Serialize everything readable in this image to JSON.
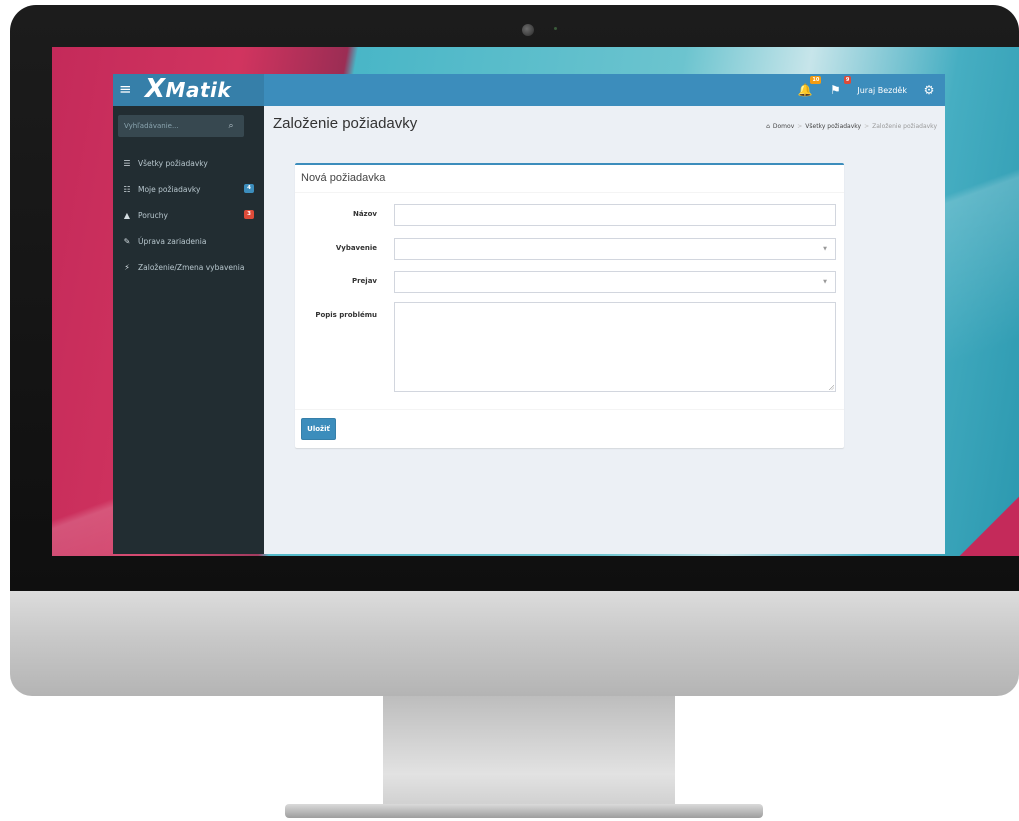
{
  "app": {
    "logo_text": "Matik",
    "logo_prefix": "X",
    "user_name": "Juraj Bezděk",
    "notifications_count": "10",
    "flags_count": "9"
  },
  "sidebar": {
    "search_placeholder": "Vyhľadávanie...",
    "items": [
      {
        "label": "Všetky požiadavky",
        "icon": "list-icon"
      },
      {
        "label": "Moje požiadavky",
        "icon": "list-ul-icon",
        "badge": "4",
        "badge_color": "#3c8dbc"
      },
      {
        "label": "Poruchy",
        "icon": "warning-icon",
        "badge": "3",
        "badge_color": "#dd4b39"
      },
      {
        "label": "Úprava zariadenia",
        "icon": "pencil-icon"
      },
      {
        "label": "Založenie/Zmena vybavenia",
        "icon": "plug-icon"
      }
    ]
  },
  "content": {
    "page_title": "Založenie požiadavky",
    "breadcrumb": [
      "Domov",
      "Všetky požiadavky",
      "Založenie požiadavky"
    ],
    "box_title": "Nová požiadavka",
    "form": {
      "name_label": "Názov",
      "name_value": "",
      "equipment_label": "Vybavenie",
      "equipment_value": "",
      "wish_label": "Prejav",
      "wish_value": "",
      "description_label": "Popis problému",
      "description_value": ""
    },
    "save_label": "Uložiť"
  },
  "colors": {
    "primary": "#3c8dbc",
    "primary_dark": "#367fa9",
    "sidebar_bg": "#222d32",
    "content_bg": "#ecf0f5",
    "danger": "#dd4b39",
    "warning": "#f39c12"
  }
}
